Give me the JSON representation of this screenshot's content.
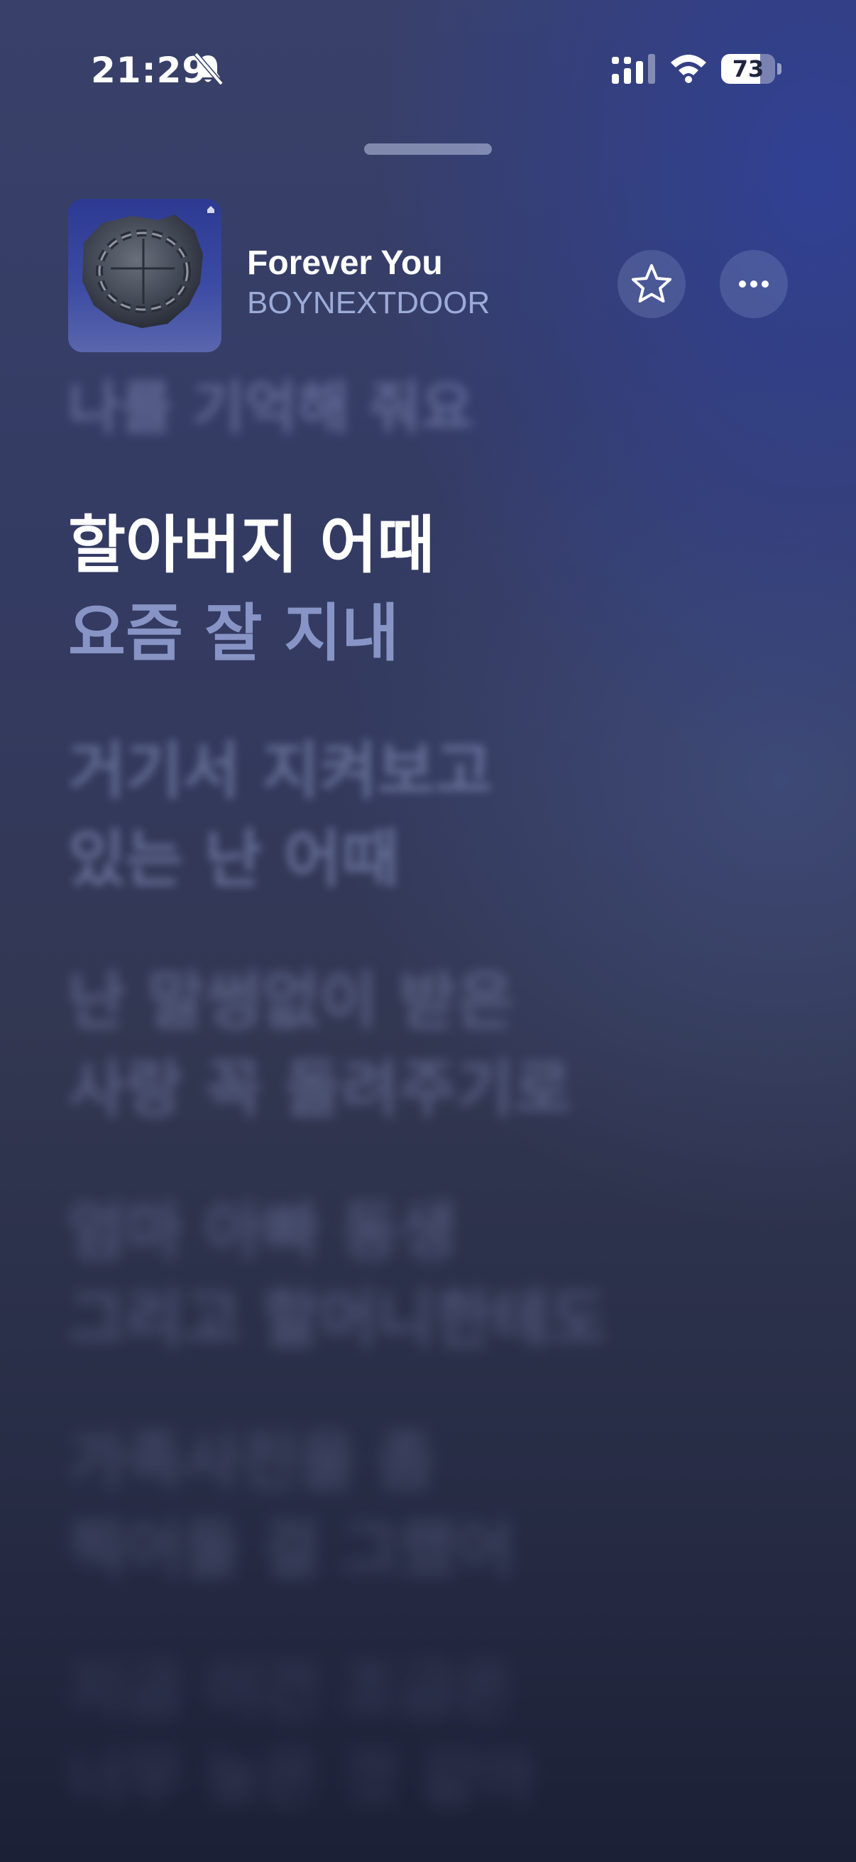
{
  "status_bar": {
    "time": "21:29",
    "battery": "73",
    "battery_percent": 73,
    "icons": [
      "bell-slash-icon",
      "cellular-signal-icon",
      "wifi-icon",
      "battery-icon"
    ]
  },
  "now_playing": {
    "title": "Forever You",
    "artist": "BOYNEXTDOOR",
    "favorite_icon": "star-outline-icon",
    "more_icon": "ellipsis-icon"
  },
  "lyrics": {
    "previous": "나를 기억해 줘요",
    "current": [
      "할아버지 어때",
      "요즘 잘 지내"
    ],
    "upcoming": [
      [
        "거기서 지켜보고",
        "있는 난 어때"
      ],
      [
        "난 말썽없이 받은",
        "사랑 꼭 돌려주기로"
      ],
      [
        "엄마 아빠 동생",
        "그리고 할머니한테도"
      ],
      [
        "가족사진을 좀",
        "찍어둘 걸 그랬어"
      ],
      [
        "지금 이건 조금은",
        "너무 늦은 것 같아"
      ]
    ]
  },
  "colors": {
    "accent": "#2f3f96",
    "lyric_active": "#ffffff",
    "lyric_secondary": "#96a5d7"
  }
}
